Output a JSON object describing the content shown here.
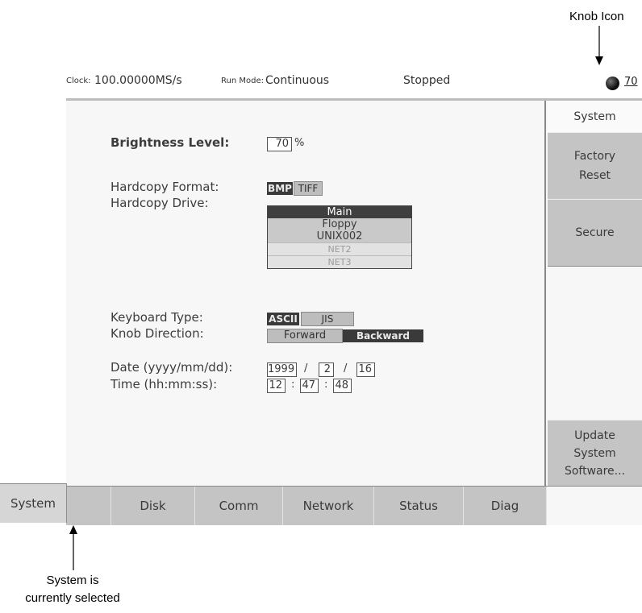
{
  "callouts": {
    "knob_icon": "Knob Icon",
    "system_selected_line1": "System is",
    "system_selected_line2": "currently selected"
  },
  "status_bar": {
    "clock_label": "Clock:",
    "clock_value": "100.00000MS/s",
    "run_mode_label": "Run Mode:",
    "run_mode_value": "Continuous",
    "state": "Stopped",
    "knob_value": "70"
  },
  "settings": {
    "brightness_label": "Brightness Level:",
    "brightness_value": "70",
    "brightness_unit": "%",
    "hardcopy_format_label": "Hardcopy Format:",
    "hardcopy_format_options": [
      "BMP",
      "TIFF"
    ],
    "hardcopy_format_selected": "BMP",
    "hardcopy_drive_label": "Hardcopy Drive:",
    "hardcopy_drive_options": [
      "Main",
      "Floppy",
      "UNIX002",
      "NET2",
      "NET3"
    ],
    "hardcopy_drive_selected": "Main",
    "keyboard_type_label": "Keyboard Type:",
    "keyboard_type_options": [
      "ASCII",
      "JIS"
    ],
    "keyboard_type_selected": "ASCII",
    "knob_direction_label": "Knob Direction:",
    "knob_direction_options": [
      "Forward",
      "Backward"
    ],
    "knob_direction_selected": "Backward",
    "date_label": "Date (yyyy/mm/dd):",
    "date_year": "1999",
    "date_month": "2",
    "date_day": "16",
    "date_sep": "/",
    "time_label": "Time (hh:mm:ss):",
    "time_hour": "12",
    "time_minute": "47",
    "time_second": "48",
    "time_sep": ":"
  },
  "side_menu": {
    "system": "System",
    "factory_line1": "Factory",
    "factory_line2": "Reset",
    "secure": "Secure",
    "update_line1": "Update",
    "update_line2": "System",
    "update_line3": "Software..."
  },
  "bottom_tabs": [
    "System",
    "Disk",
    "Comm",
    "Network",
    "Status",
    "Diag"
  ],
  "selected_tab": "System",
  "colors": {
    "menu_bg": "#c4c4c4",
    "selected_fill": "#3a3a3a",
    "screen_bg": "#f7f7f7"
  }
}
